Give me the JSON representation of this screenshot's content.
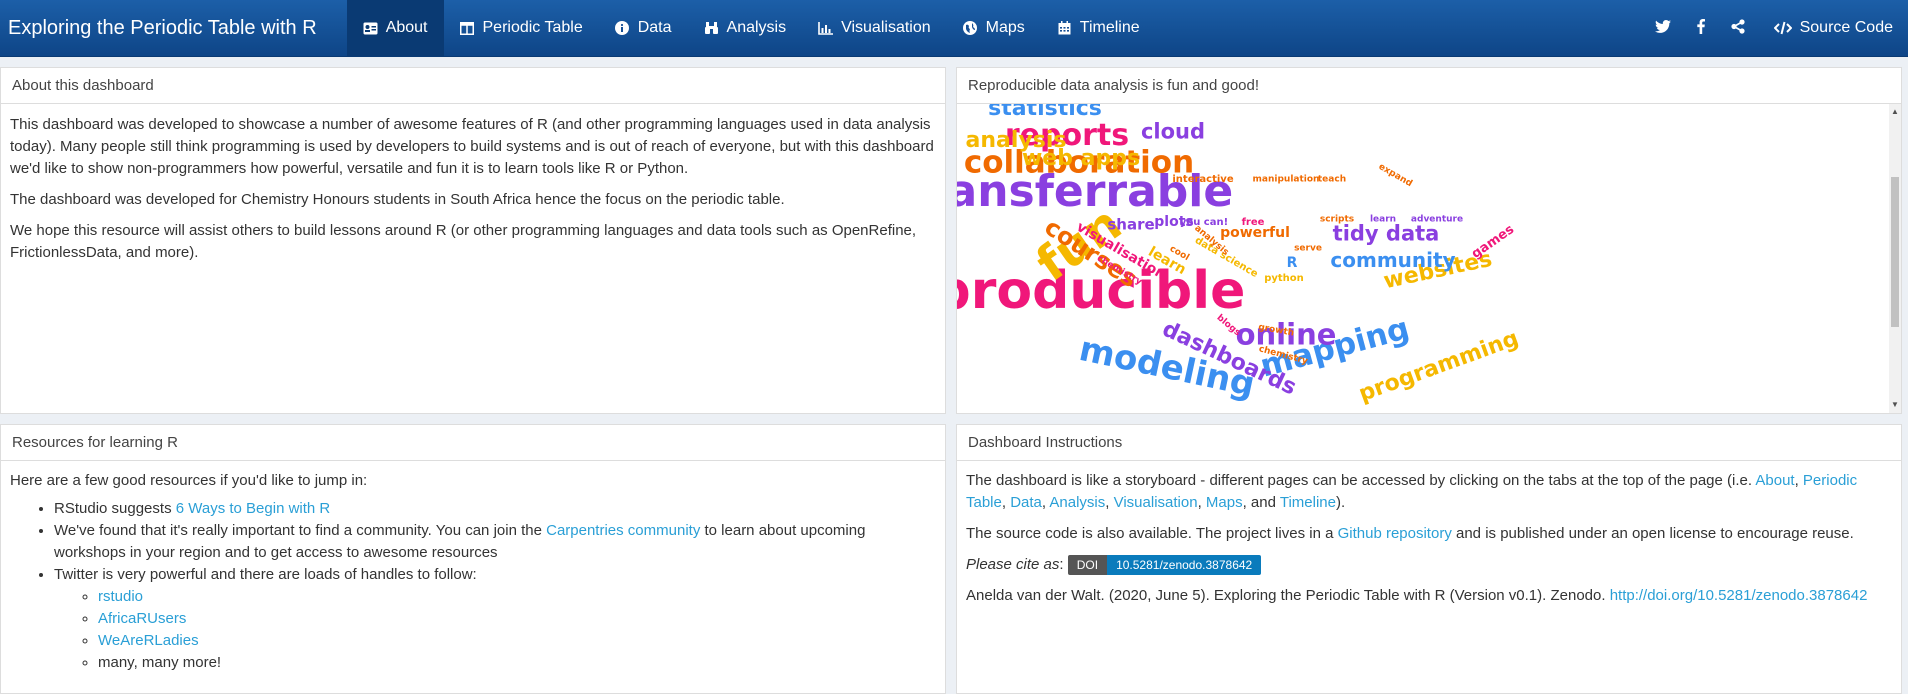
{
  "app": {
    "title": "Exploring the Periodic Table with R"
  },
  "nav": {
    "tabs": [
      {
        "label": "About",
        "icon": "id-card-icon",
        "active": true
      },
      {
        "label": "Periodic Table",
        "icon": "table-icon"
      },
      {
        "label": "Data",
        "icon": "info-circle-icon"
      },
      {
        "label": "Analysis",
        "icon": "binoculars-icon"
      },
      {
        "label": "Visualisation",
        "icon": "bar-chart-icon"
      },
      {
        "label": "Maps",
        "icon": "globe-icon"
      },
      {
        "label": "Timeline",
        "icon": "calendar-icon"
      }
    ],
    "right": [
      {
        "icon": "twitter-icon"
      },
      {
        "icon": "facebook-icon"
      },
      {
        "icon": "share-icon"
      },
      {
        "icon": "code-icon",
        "label": "Source Code"
      }
    ]
  },
  "about": {
    "title": "About this dashboard",
    "p1": "This dashboard was developed to showcase a number of awesome features of R (and other programming languages used in data analysis today). Many people still think programming is used by developers to build systems and is out of reach of everyone, but with this dashboard we'd like to show non-programmers how powerful, versatile and fun it is to learn tools like R or Python.",
    "p2": "The dashboard was developed for Chemistry Honours students in South Africa hence the focus on the periodic table.",
    "p3": "We hope this resource will assist others to build lessons around R (or other programming languages and data tools such as OpenRefine, FrictionlessData, and more)."
  },
  "wordcloud": {
    "title": "Reproducible data analysis is fun and good!",
    "words": [
      {
        "text": "reproducible",
        "color": "#f0177a"
      },
      {
        "text": "transferrable",
        "color": "#8a3fe0"
      },
      {
        "text": "fun",
        "color": "#f5b800"
      },
      {
        "text": "collaboration",
        "color": "#f06a00"
      },
      {
        "text": "reports",
        "color": "#f0177a"
      },
      {
        "text": "statistics",
        "color": "#3b8ff0"
      },
      {
        "text": "cloud",
        "color": "#8a3fe0"
      },
      {
        "text": "analysis",
        "color": "#f5b800"
      },
      {
        "text": "web apps",
        "color": "#f5b800"
      },
      {
        "text": "modeling",
        "color": "#3b8ff0"
      },
      {
        "text": "mapping",
        "color": "#3b8ff0"
      },
      {
        "text": "online",
        "color": "#8a3fe0"
      },
      {
        "text": "dashboards",
        "color": "#8a3fe0"
      },
      {
        "text": "programming",
        "color": "#f5b800"
      },
      {
        "text": "websites",
        "color": "#f5b800"
      },
      {
        "text": "community",
        "color": "#3b8ff0"
      },
      {
        "text": "tidy data",
        "color": "#8a3fe0"
      },
      {
        "text": "courses",
        "color": "#f06a00"
      },
      {
        "text": "visualisation",
        "color": "#f0177a"
      },
      {
        "text": "games",
        "color": "#f0177a"
      },
      {
        "text": "share",
        "color": "#8a3fe0"
      },
      {
        "text": "plots",
        "color": "#8a3fe0"
      },
      {
        "text": "powerful",
        "color": "#f06a00"
      },
      {
        "text": "learn",
        "color": "#f5b800"
      },
      {
        "text": "interactive",
        "color": "#f06a00"
      },
      {
        "text": "manipulation",
        "color": "#f06a00"
      },
      {
        "text": "teach",
        "color": "#f06a00"
      },
      {
        "text": "expand",
        "color": "#f06a00"
      },
      {
        "text": "you can!",
        "color": "#8a3fe0"
      },
      {
        "text": "free",
        "color": "#f0177a"
      },
      {
        "text": "scripts",
        "color": "#f06a00"
      },
      {
        "text": "learn",
        "color": "#8a3fe0"
      },
      {
        "text": "adventure",
        "color": "#8a3fe0"
      },
      {
        "text": "chemistry",
        "color": "#f0177a"
      },
      {
        "text": "growth",
        "color": "#f06a00"
      },
      {
        "text": "blogs",
        "color": "#f0177a"
      },
      {
        "text": "chemistry",
        "color": "#f06a00"
      },
      {
        "text": "serve",
        "color": "#f06a00"
      },
      {
        "text": "cool",
        "color": "#f06a00"
      },
      {
        "text": "R",
        "color": "#3b8ff0"
      },
      {
        "text": "python",
        "color": "#f5b800"
      },
      {
        "text": "data science",
        "color": "#f5b800"
      },
      {
        "text": "analysis",
        "color": "#f06a00"
      }
    ]
  },
  "resources": {
    "title": "Resources for learning R",
    "intro": "Here are a few good resources if you'd like to jump in:",
    "item1_pre": "RStudio suggests ",
    "item1_link": "6 Ways to Begin with R",
    "item2_pre": "We've found that it's really important to find a community. You can join the ",
    "item2_link": "Carpentries community",
    "item2_post": " to learn about upcoming workshops in your region and to get access to awesome resources",
    "item3": "Twitter is very powerful and there are loads of handles to follow:",
    "handles": [
      "rstudio",
      "AfricaRUsers",
      "WeAreRLadies"
    ],
    "more": "many, many more!"
  },
  "instructions": {
    "title": "Dashboard Instructions",
    "p1_pre": "The dashboard is like a storyboard - different pages can be accessed by clicking on the tabs at the top of the page (i.e. ",
    "links": [
      "About",
      "Periodic Table",
      "Data",
      "Analysis",
      "Visualisation",
      "Maps",
      "Timeline"
    ],
    "sep": ", ",
    "and": ", and ",
    "p1_post": ").",
    "p2_pre": "The source code is also available. The project lives in a ",
    "p2_link": "Github repository",
    "p2_post": " and is published under an open license to encourage reuse.",
    "cite_label": "Please cite as",
    "cite_colon": ":",
    "doi_label": "DOI",
    "doi_value": "10.5281/zenodo.3878642",
    "citation": "Anelda van der Walt. (2020, June 5). Exploring the Periodic Table with R (Version v0.1). Zenodo. ",
    "citation_link": "http://doi.org/10.5281/zenodo.3878642"
  },
  "colors": {
    "nav": "#1c5fa8",
    "link": "#2a9fd6",
    "doi": "#0a7bbc"
  }
}
